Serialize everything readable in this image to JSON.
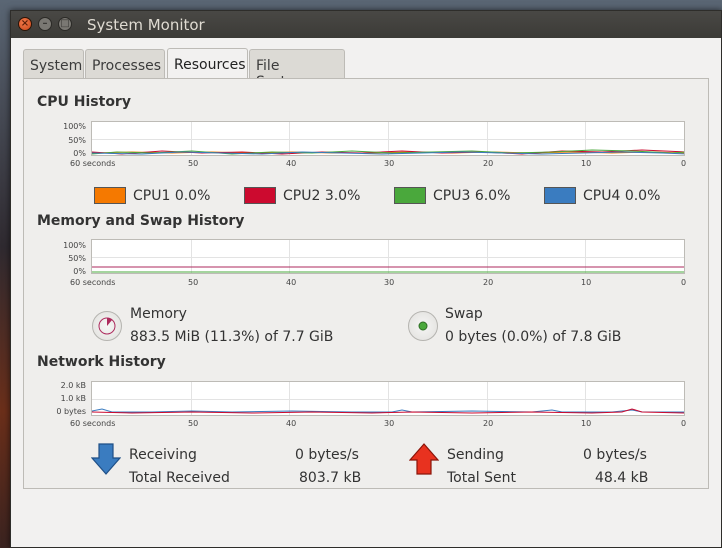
{
  "window": {
    "title": "System Monitor"
  },
  "tabs": [
    {
      "label": "System"
    },
    {
      "label": "Processes"
    },
    {
      "label": "Resources"
    },
    {
      "label": "File Systems"
    }
  ],
  "cpu": {
    "title": "CPU History",
    "y_ticks": [
      "100%",
      "50%",
      "0%"
    ],
    "x_ticks": [
      "60 seconds",
      "50",
      "40",
      "30",
      "20",
      "10",
      "0"
    ],
    "legend": [
      {
        "label": "CPU1",
        "value": "0.0%",
        "color": "#f57900"
      },
      {
        "label": "CPU2",
        "value": "3.0%",
        "color": "#cc0a2f"
      },
      {
        "label": "CPU3",
        "value": "6.0%",
        "color": "#4aa83c"
      },
      {
        "label": "CPU4",
        "value": "0.0%",
        "color": "#3a7cc0"
      }
    ]
  },
  "memory": {
    "title": "Memory and Swap History",
    "y_ticks": [
      "100%",
      "50%",
      "0%"
    ],
    "x_ticks": [
      "60 seconds",
      "50",
      "40",
      "30",
      "20",
      "10",
      "0"
    ],
    "mem_label": "Memory",
    "mem_value": "883.5 MiB (11.3%) of 7.7 GiB",
    "mem_color": "#ad2a5d",
    "swap_label": "Swap",
    "swap_value": "0 bytes (0.0%) of 7.8 GiB",
    "swap_color": "#4aa83c"
  },
  "network": {
    "title": "Network History",
    "y_ticks": [
      "2.0 kB",
      "1.0 kB",
      "0 bytes"
    ],
    "x_ticks": [
      "60 seconds",
      "50",
      "40",
      "30",
      "20",
      "10",
      "0"
    ],
    "receiving_label": "Receiving",
    "receiving_value": "0 bytes/s",
    "total_received_label": "Total Received",
    "total_received_value": "803.7 kB",
    "sending_label": "Sending",
    "sending_value": "0 bytes/s",
    "total_sent_label": "Total Sent",
    "total_sent_value": "48.4 kB",
    "receive_color": "#3a7cc0",
    "send_color": "#cc0a2f"
  }
}
